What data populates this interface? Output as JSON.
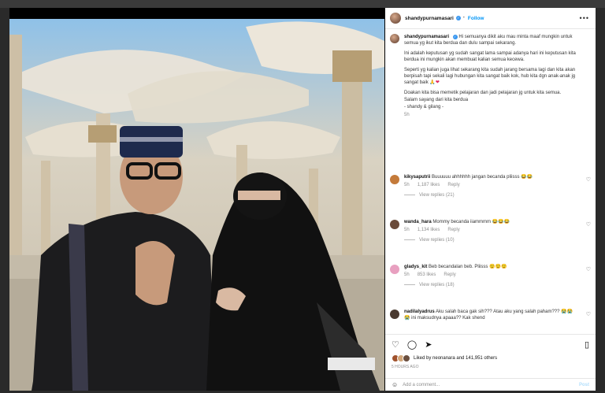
{
  "post": {
    "username": "shandypurnamasari",
    "follow_label": "Follow",
    "more_icon": "•••",
    "caption_paragraphs": [
      "Hi semuanya dikit aku mau minta maaf mungkin untuk semua yg ikut kita berdua dan dulu sampai sekarang.",
      "Ini adalah keputusan yg sudah sangat lama sampai adanya hari ini keputusan kita berdua ini mungkin akan membuat kalian semua kecewa.",
      "Seperti yg kalian juga lihat sekarang kita sudah jarang bersama lagi dan kita akan berpisah tapi sekali lagi hubungan kita sangat baik kok, hub kita dgn anak-anak jg sangat baik",
      "Doakan kita bisa memetik pelajaran dan jadi pelajaran jg untuk kita semua.",
      "Salam sayang dari kita berdua",
      "- shandy & gilang -"
    ],
    "caption_time": "5h"
  },
  "comments": [
    {
      "user": "kikysaputrii",
      "text": "Buuuuuu ahhhhhh jangan becanda pliisss",
      "emoji": "😂😂",
      "time": "5h",
      "likes": "1,187 likes",
      "reply": "Reply",
      "view_replies": "View replies (21)",
      "color": "#c47a3a"
    },
    {
      "user": "wanda_hara",
      "text": "Mommy becanda iiammmm",
      "emoji": "😂😂😂",
      "time": "5h",
      "likes": "1,134 likes",
      "reply": "Reply",
      "view_replies": "View replies (10)",
      "color": "#6a4b3a"
    },
    {
      "user": "gladys_kit",
      "text": "Beb becandalan beb. Pliisss",
      "emoji": "😟😟😟",
      "time": "5h",
      "likes": "853 likes",
      "reply": "Reply",
      "view_replies": "View replies (18)",
      "color": "#e8a0c0"
    },
    {
      "user": "nadilalyadrus",
      "text": "Aku salah baca gak sih??? Atau aku yang salah paham??? 😭😭😭 ini maksudnya apaaa?? Kak shend",
      "emoji": "",
      "time": "",
      "likes": "",
      "reply": "",
      "view_replies": "",
      "color": "#4a3a30"
    }
  ],
  "footer": {
    "liked_by": "Liked by neonanara and 141,951 others",
    "ago": "5 HOURS AGO",
    "add_comment_placeholder": "Add a comment...",
    "post_label": "Post"
  },
  "icons": {
    "like": "heart-icon",
    "comment": "comment-icon",
    "share": "share-icon",
    "save": "bookmark-icon",
    "emoji": "emoji-icon"
  }
}
